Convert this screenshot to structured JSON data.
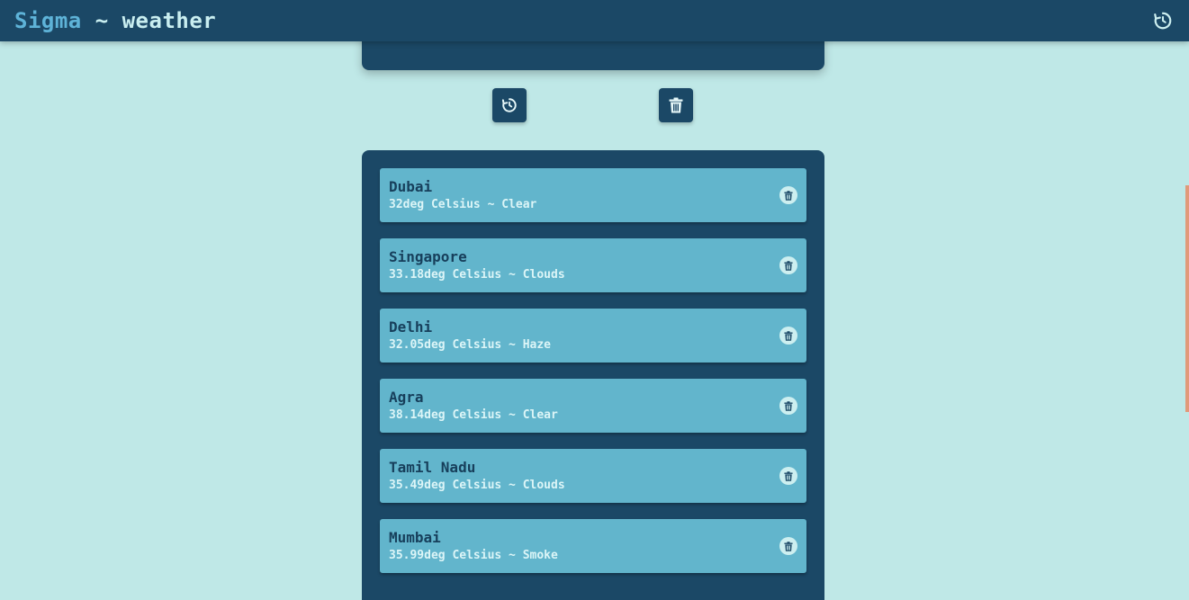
{
  "header": {
    "brand_primary": "Sigma",
    "brand_secondary": " ~ weather",
    "refresh_icon": "history-icon"
  },
  "actions": {
    "refresh_icon": "history-icon",
    "clear_icon": "trash-icon"
  },
  "cities": [
    {
      "name": "Dubai",
      "info": "32deg Celsius ~ Clear"
    },
    {
      "name": "Singapore",
      "info": "33.18deg Celsius ~ Clouds"
    },
    {
      "name": "Delhi",
      "info": "32.05deg Celsius ~ Haze"
    },
    {
      "name": "Agra",
      "info": "38.14deg Celsius ~ Clear"
    },
    {
      "name": "Tamil Nadu",
      "info": "35.49deg Celsius ~ Clouds"
    },
    {
      "name": "Mumbai",
      "info": "35.99deg Celsius ~ Smoke"
    }
  ],
  "colors": {
    "background": "#bfe8e7",
    "primary": "#1b4866",
    "card": "#62b5cc",
    "accent": "#5eb3d8",
    "scroll_indicator": "#e19a7a"
  }
}
